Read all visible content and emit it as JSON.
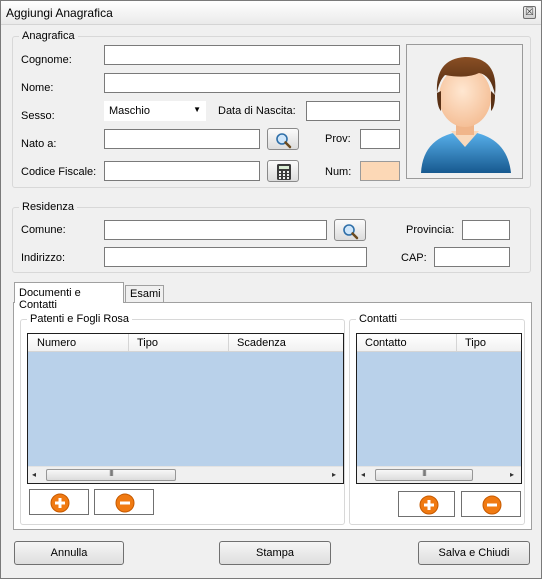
{
  "window": {
    "title": "Aggiungi Anagrafica",
    "close_glyph": "☒"
  },
  "anagrafica": {
    "legend": "Anagrafica",
    "cognome_label": "Cognome:",
    "cognome_value": "",
    "nome_label": "Nome:",
    "nome_value": "",
    "sesso_label": "Sesso:",
    "sesso_value": "Maschio",
    "data_nascita_label": "Data di Nascita:",
    "data_nascita_value": "",
    "nato_a_label": "Nato a:",
    "nato_a_value": "",
    "prov_label": "Prov:",
    "prov_value": "",
    "codice_fiscale_label": "Codice Fiscale:",
    "codice_fiscale_value": "",
    "num_label": "Num:",
    "num_value": ""
  },
  "residenza": {
    "legend": "Residenza",
    "comune_label": "Comune:",
    "comune_value": "",
    "provincia_label": "Provincia:",
    "provincia_value": "",
    "indirizzo_label": "Indirizzo:",
    "indirizzo_value": "",
    "cap_label": "CAP:",
    "cap_value": ""
  },
  "tabs": [
    {
      "label": "Documenti e Contatti",
      "active": true
    },
    {
      "label": "Esami",
      "active": false
    }
  ],
  "patenti": {
    "legend": "Patenti e Fogli Rosa",
    "columns": [
      "Numero",
      "Tipo",
      "Scadenza"
    ],
    "rows": []
  },
  "contatti": {
    "legend": "Contatti",
    "columns": [
      "Contatto",
      "Tipo"
    ],
    "rows": []
  },
  "scrollbar": {
    "left_glyph": "◂",
    "right_glyph": "▸",
    "grip_glyph": "III"
  },
  "footer": {
    "annulla": "Annulla",
    "stampa": "Stampa",
    "salva_chiudi": "Salva e Chiudi"
  },
  "icons": {
    "search": "magnifier-icon",
    "calculator": "calculator-icon",
    "add": "plus-circle-icon",
    "remove": "minus-circle-icon",
    "avatar": "user-avatar-icon"
  },
  "colors": {
    "list_background": "#b9d1ea",
    "num_field": "#fcd8b6",
    "add_remove_orange": "#f07a12"
  }
}
